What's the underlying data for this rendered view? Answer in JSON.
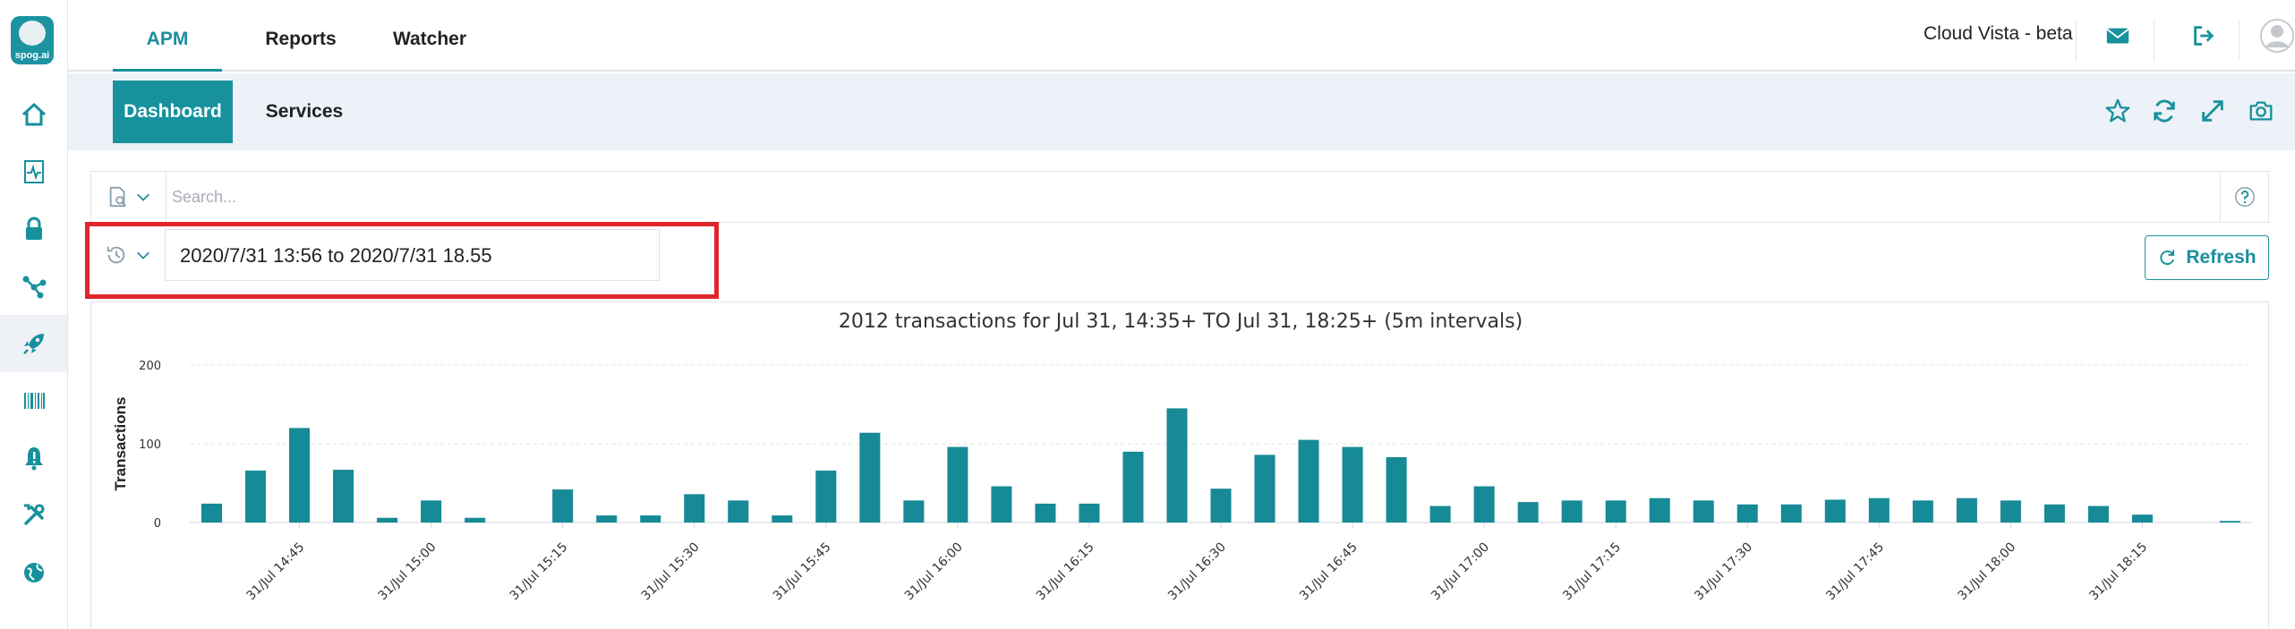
{
  "app": {
    "logo_text": "spog.ai"
  },
  "sidebar": {
    "items": [
      {
        "icon": "home-icon"
      },
      {
        "icon": "heartbeat-icon"
      },
      {
        "icon": "lock-icon"
      },
      {
        "icon": "network-icon"
      },
      {
        "icon": "rocket-icon",
        "active": true
      },
      {
        "icon": "barcode-icon"
      },
      {
        "icon": "alert-bell-icon"
      },
      {
        "icon": "tools-icon"
      },
      {
        "icon": "globe-icon"
      }
    ]
  },
  "top_tabs": [
    {
      "label": "APM",
      "active": true
    },
    {
      "label": "Reports"
    },
    {
      "label": "Watcher"
    }
  ],
  "header": {
    "tenant": "Cloud Vista - beta",
    "icons": [
      "mail-icon",
      "logout-icon",
      "user-avatar-icon"
    ]
  },
  "sub_tabs": [
    {
      "label": "Dashboard",
      "active": true
    },
    {
      "label": "Services"
    }
  ],
  "sub_icons": [
    "star-icon",
    "sync-icon",
    "expand-icon",
    "camera-icon"
  ],
  "search": {
    "placeholder": "Search..."
  },
  "time": {
    "range": "2020/7/31 13:56 to 2020/7/31 18.55",
    "refresh_label": "Refresh"
  },
  "colors": {
    "accent": "#17919c",
    "bar": "#178a97",
    "highlight": "#e0252d"
  },
  "chart_data": {
    "type": "bar",
    "title": "2012 transactions for Jul 31, 14:35+ TO Jul 31, 18:25+ (5m intervals)",
    "ylabel": "Transactions",
    "ylim": [
      0,
      200
    ],
    "yticks": [
      0,
      100,
      200
    ],
    "grid": true,
    "tick_labels": [
      "31/Jul 14:45",
      "31/Jul 15:00",
      "31/Jul 15:15",
      "31/Jul 15:30",
      "31/Jul 15:45",
      "31/Jul 16:00",
      "31/Jul 16:15",
      "31/Jul 16:30",
      "31/Jul 16:45",
      "31/Jul 17:00",
      "31/Jul 17:15",
      "31/Jul 17:30",
      "31/Jul 17:45",
      "31/Jul 18:00",
      "31/Jul 18:15"
    ],
    "x": [
      "14:35",
      "14:40",
      "14:45",
      "14:50",
      "14:55",
      "15:00",
      "15:05",
      "15:10",
      "15:15",
      "15:20",
      "15:25",
      "15:30",
      "15:35",
      "15:40",
      "15:45",
      "15:50",
      "15:55",
      "16:00",
      "16:05",
      "16:10",
      "16:15",
      "16:20",
      "16:25",
      "16:30",
      "16:35",
      "16:40",
      "16:45",
      "16:50",
      "16:55",
      "17:00",
      "17:05",
      "17:10",
      "17:15",
      "17:20",
      "17:25",
      "17:30",
      "17:35",
      "17:40",
      "17:45",
      "17:50",
      "17:55",
      "18:00",
      "18:05",
      "18:10",
      "18:15",
      "18:20",
      "18:25"
    ],
    "values": [
      24,
      66,
      120,
      67,
      6,
      28,
      6,
      0,
      42,
      9,
      9,
      36,
      28,
      9,
      66,
      114,
      28,
      96,
      46,
      24,
      24,
      90,
      145,
      43,
      86,
      105,
      96,
      83,
      21,
      46,
      26,
      28,
      28,
      31,
      28,
      23,
      23,
      29,
      31,
      28,
      31,
      28,
      23,
      21,
      10,
      0,
      2
    ]
  }
}
